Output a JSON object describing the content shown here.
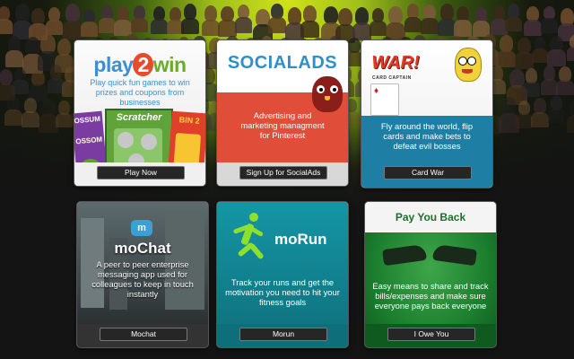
{
  "cards": [
    {
      "logo": "play2win",
      "description": "Play quick fun games to win prizes and coupons from businesses",
      "button": "Play Now",
      "tiles": [
        "OSSUM",
        "OSSOM",
        "Scratcher",
        "BIN 2"
      ]
    },
    {
      "logo": "SOCIALADS",
      "description": "Advertising and marketing managment for Pinterest",
      "button": "Sign Up for SocialAds",
      "accent": "#e04e3a"
    },
    {
      "logo": "WAR!",
      "sublogo": "CARD CAPTAIN",
      "description": "Fly around the world, flip cards and make bets to defeat evil bosses",
      "button": "Card War",
      "accent": "#1f7ea3"
    },
    {
      "logo": "moChat",
      "description": "A peer to peer enterprise messaging app used for colleagues to keep in touch instantly",
      "button": "Mochat"
    },
    {
      "logo": "moRun",
      "description": "Track your runs and get the motivation you need to hit your fitness goals",
      "button": "Morun",
      "accent": "#1596a6"
    },
    {
      "logo": "Pay You Back",
      "description": "Easy means to share and track bills/expenses and make sure everyone pays back everyone",
      "button": "I Owe You",
      "accent": "#1c7f2e"
    }
  ]
}
